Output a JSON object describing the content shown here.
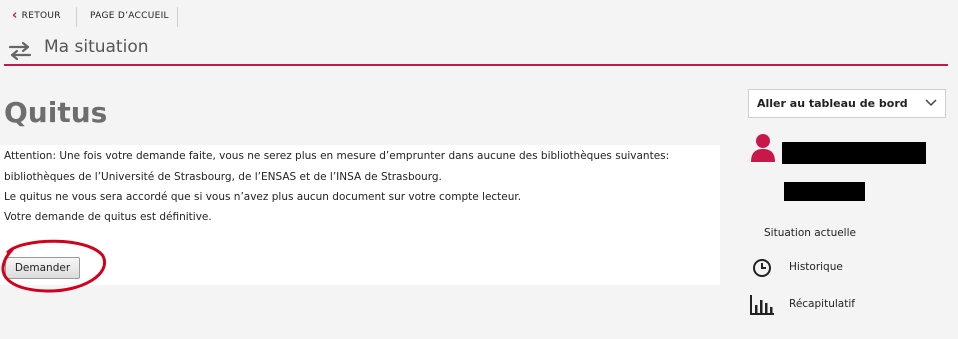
{
  "nav": {
    "back_label": "RETOUR",
    "home_label": "PAGE D’ACCUEIL"
  },
  "header": {
    "title": "Ma situation",
    "title_icon": "swap-arrows-icon"
  },
  "main": {
    "heading": "Quitus",
    "paragraphs": [
      "Attention: Une fois votre demande faite, vous ne serez plus en mesure d’emprunter dans aucune des bibliothèques suivantes:",
      "bibliothèques de l’Université de Strasbourg, de l’ENSAS et de l’INSA de Strasbourg.",
      "Le quitus ne vous sera accordé que si vous n’avez plus aucun document sur votre compte lecteur.",
      "Votre demande de quitus est définitive."
    ],
    "button_label": "Demander"
  },
  "sidebar": {
    "dashboard_select": "Aller au tableau de bord",
    "links": [
      {
        "label": "Situation actuelle",
        "icon": ""
      },
      {
        "label": "Historique",
        "icon": "clock-icon"
      },
      {
        "label": "Récapitulatif",
        "icon": "bar-chart-icon"
      }
    ]
  },
  "colors": {
    "accent": "#c8184a",
    "annotation": "#d0021b"
  }
}
